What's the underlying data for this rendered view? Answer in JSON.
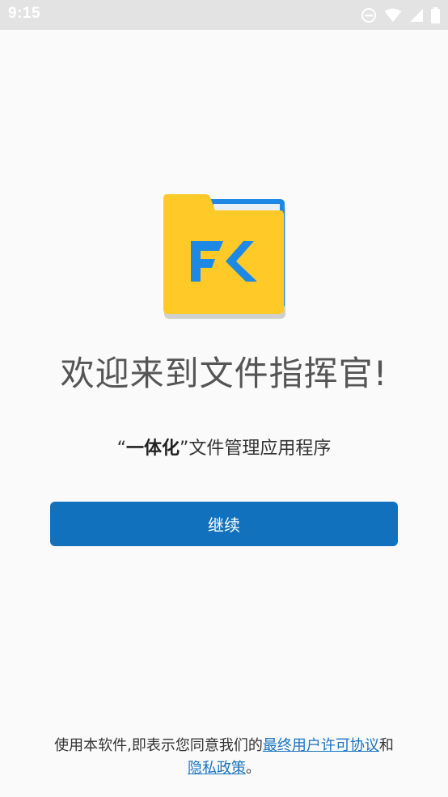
{
  "status_bar": {
    "time": "9:15",
    "icons": [
      "do-not-disturb-icon",
      "wifi-icon",
      "signal-icon",
      "battery-icon"
    ]
  },
  "colors": {
    "accent": "#1171bd",
    "folder_yellow": "#ffca28",
    "folder_blue": "#1e88e5",
    "link": "#1a74c2"
  },
  "welcome": {
    "title": "欢迎来到文件指挥官!",
    "subtitle_quote_open": "“",
    "subtitle_strong": "一体化",
    "subtitle_quote_close": "”",
    "subtitle_rest": "文件管理应用程序"
  },
  "actions": {
    "continue_label": "继续"
  },
  "terms": {
    "prefix": "使用本软件,即表示您同意我们的",
    "eula_link": "最终用户许可协议",
    "conjunction": "和",
    "privacy_link": "隐私政策",
    "suffix": "。"
  }
}
